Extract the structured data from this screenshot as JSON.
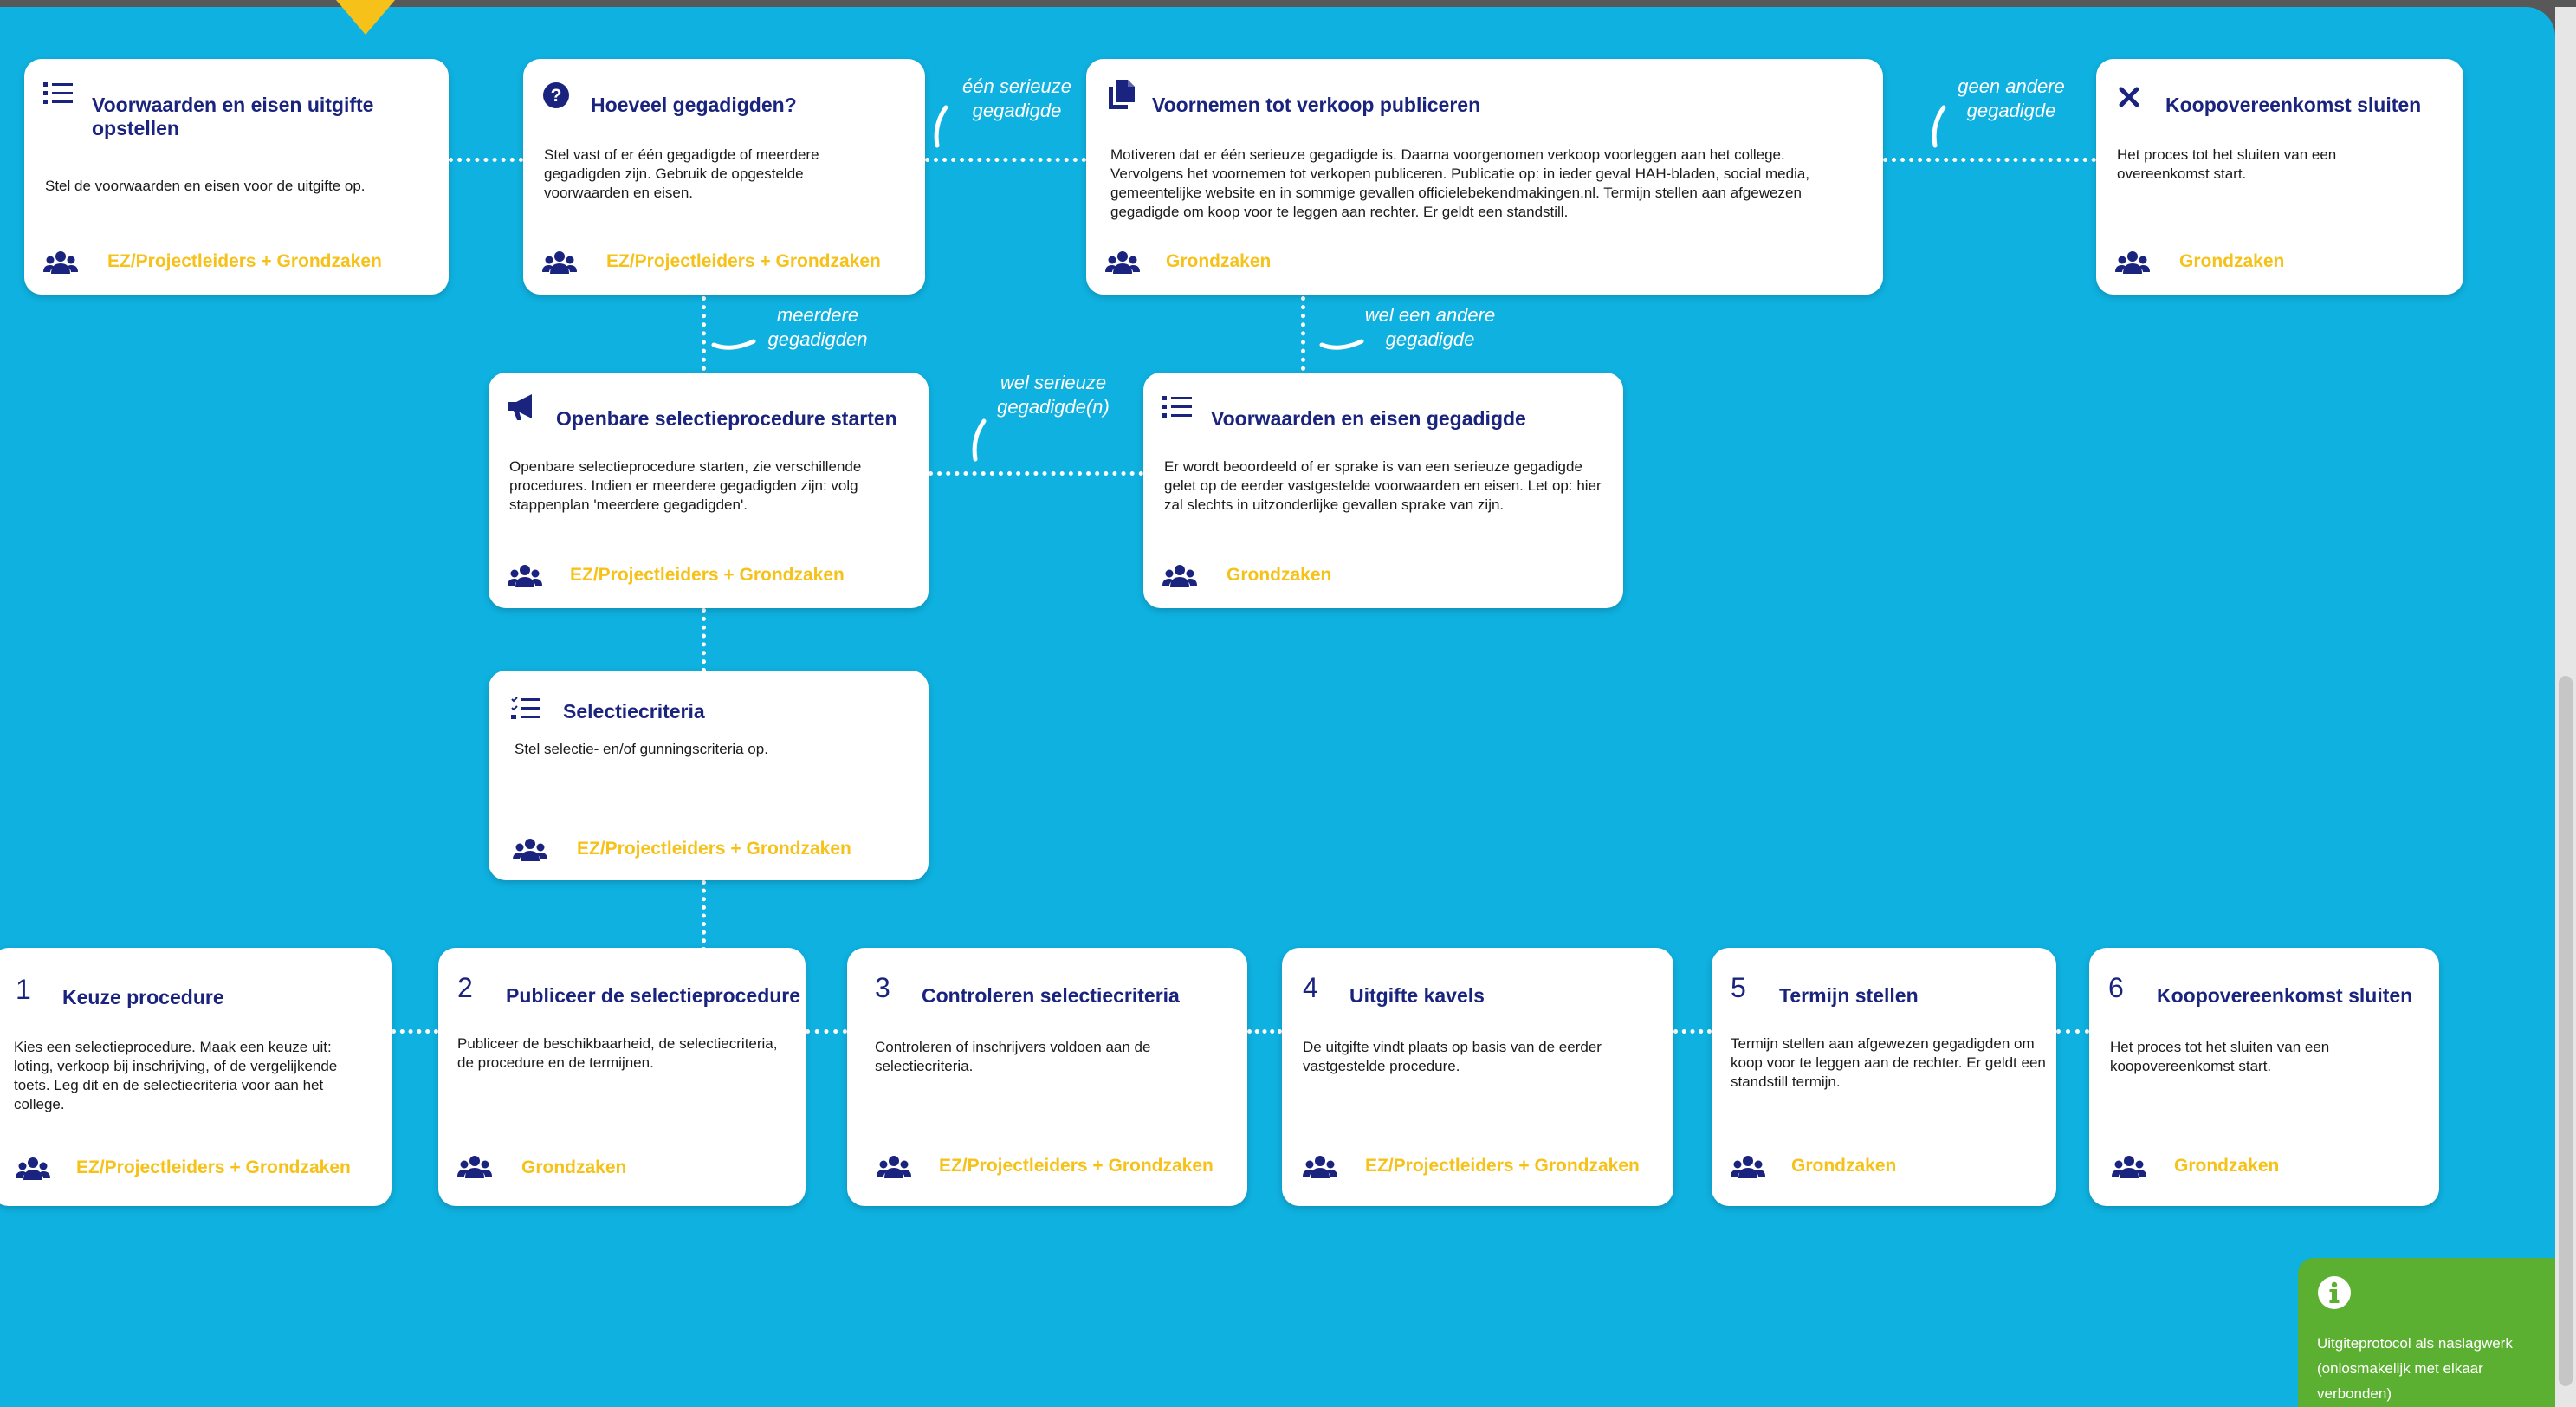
{
  "diagram": {
    "top_cards": [
      {
        "icon": "list-icon",
        "title": "Voorwaarden en eisen uitgifte opstellen",
        "desc": "Stel de voorwaarden en eisen voor de uitgifte op.",
        "role": "EZ/Projectleiders + Grondzaken"
      },
      {
        "icon": "question-icon",
        "title": "Hoeveel gegadigden?",
        "desc": "Stel vast of er één gegadigde of meerdere gegadigden zijn. Gebruik de opgestelde voorwaarden en eisen.",
        "role": "EZ/Projectleiders + Grondzaken"
      },
      {
        "icon": "documents-icon",
        "title": "Voornemen tot verkoop publiceren",
        "desc": "Motiveren dat er één serieuze gegadigde is. Daarna voorgenomen verkoop voorleggen aan het college. Vervolgens het voornemen tot verkopen publiceren. Publicatie op: in ieder geval HAH-bladen, social media, gemeentelijke website en in sommige gevallen officielebekendmakingen.nl. Termijn stellen aan afgewezen gegadigde om koop voor te leggen aan rechter. Er geldt een standstill.",
        "role": "Grondzaken"
      },
      {
        "icon": "close-icon",
        "title": "Koopovereenkomst sluiten",
        "desc": "Het proces tot het sluiten van een overeenkomst start.",
        "role": "Grondzaken"
      }
    ],
    "middle_cards": [
      {
        "icon": "megaphone-icon",
        "title": "Openbare selectieprocedure starten",
        "desc": "Openbare selectieprocedure starten, zie verschillende procedures. Indien er meerdere gegadigden zijn: volg stappenplan 'meerdere gegadigden'.",
        "role": "EZ/Projectleiders + Grondzaken"
      },
      {
        "icon": "list-icon",
        "title": "Voorwaarden en eisen gegadigde",
        "desc": "Er wordt beoordeeld of er sprake is van een serieuze gegadigde gelet op de eerder vastgestelde voorwaarden en eisen. Let op: hier zal slechts in uitzonderlijke gevallen sprake van zijn.",
        "role": "Grondzaken"
      },
      {
        "icon": "checklist-icon",
        "title": "Selectiecriteria",
        "desc": "Stel selectie- en/of gunningscriteria op.",
        "role": "EZ/Projectleiders + Grondzaken"
      }
    ],
    "branch_labels": {
      "een_serieuze": [
        "één serieuze",
        "gegadigde"
      ],
      "geen_andere": [
        "geen andere",
        "gegadigde"
      ],
      "meerdere": [
        "meerdere",
        "gegadigden"
      ],
      "wel_andere": [
        "wel een andere",
        "gegadigde"
      ],
      "wel_serieuze": [
        "wel serieuze",
        "gegadigde(n)"
      ]
    },
    "steps": [
      {
        "number": "1",
        "title": "Keuze procedure",
        "desc": "Kies een selectieprocedure. Maak een keuze uit: loting, verkoop bij inschrijving, of de vergelijkende toets. Leg dit en de selectie­criteria voor aan het college.",
        "role": "EZ/Projectleiders + Grondzaken"
      },
      {
        "number": "2",
        "title": "Publiceer de selectieprocedure",
        "desc": "Publiceer de beschikbaarheid, de selectiecri­teria, de procedure en de termijnen.",
        "role": "Grondzaken"
      },
      {
        "number": "3",
        "title": "Controleren selectiecriteria",
        "desc": "Controleren of inschrijvers voldoen aan de selectiecriteria.",
        "role": "EZ/Projectleiders + Grondzaken"
      },
      {
        "number": "4",
        "title": "Uitgifte kavels",
        "desc": "De uitgifte vindt plaats op basis van de eerder vastgestelde procedure.",
        "role": "EZ/Projectleiders + Grondzaken"
      },
      {
        "number": "5",
        "title": "Termijn stellen",
        "desc": "Termijn stellen aan afgewezen gegadigden om koop voor te leggen aan de rechter. Er geldt een standstill termijn.",
        "role": "Grondzaken"
      },
      {
        "number": "6",
        "title": "Koopovereenkomst sluiten",
        "desc": "Het proces tot het sluiten van een koopovereenkomst start.",
        "role": "Grondzaken"
      }
    ],
    "info": {
      "icon": "info-icon",
      "text": "Uitgiteprotocol als naslagwerk (onlosmakelijk met elkaar verbonden)"
    },
    "colors": {
      "background": "#0fb1e0",
      "title": "#1a237e",
      "role": "#f6c21a",
      "info": "#5cb031",
      "marker": "#f6c21a"
    }
  }
}
